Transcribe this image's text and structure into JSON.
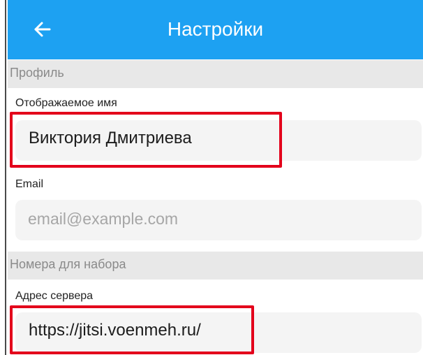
{
  "header": {
    "title": "Настройки",
    "back_icon": "arrow-left-icon",
    "background_color": "#1da1f2"
  },
  "profile_section": {
    "title": "Профиль",
    "display_name": {
      "label": "Отображаемое имя",
      "value": "Виктория Дмитриева"
    },
    "email": {
      "label": "Email",
      "placeholder": "email@example.com"
    }
  },
  "dialing_section": {
    "title": "Номера для набора",
    "server_address": {
      "label": "Адрес сервера",
      "value": "https://jitsi.voenmeh.ru/"
    }
  },
  "highlight_color": "#e3001b"
}
